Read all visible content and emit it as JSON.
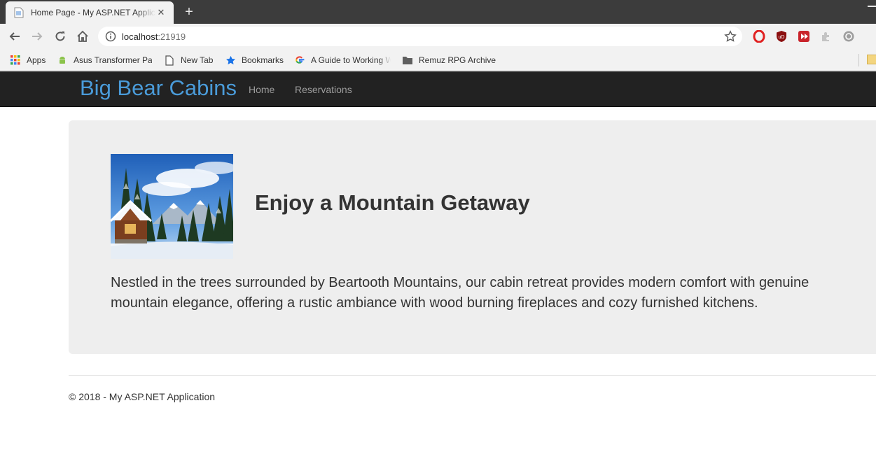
{
  "browser": {
    "tab": {
      "title": "Home Page - My ASP.NET Application",
      "close_glyph": "✕"
    },
    "new_tab_glyph": "+",
    "address": {
      "host": "localhost",
      "port": ":21919"
    },
    "bookmarks": [
      {
        "label": "Apps",
        "icon": "apps-grid-icon"
      },
      {
        "label": "Asus Transformer Pad",
        "icon": "android-icon"
      },
      {
        "label": "New Tab",
        "icon": "page-icon"
      },
      {
        "label": "Bookmarks",
        "icon": "star-icon"
      },
      {
        "label": "A Guide to Working With",
        "icon": "google-icon"
      },
      {
        "label": "Remuz RPG Archive",
        "icon": "folder-icon"
      }
    ],
    "extensions": [
      "opera-icon",
      "ublock-icon",
      "video-speed-icon",
      "puzzle-icon",
      "sync-icon"
    ]
  },
  "site": {
    "brand": "Big Bear Cabins",
    "nav": {
      "home": "Home",
      "reservations": "Reservations"
    },
    "colors": {
      "brand": "#4a9bd9",
      "navbar": "#222222",
      "jumbotron": "#eeeeee"
    }
  },
  "hero": {
    "heading": "Enjoy a Mountain Getaway",
    "text": "Nestled in the trees surrounded by Beartooth Mountains, our cabin retreat provides modern comfort with genuine mountain elegance, offering a rustic ambiance with wood burning fireplaces and cozy furnished kitchens."
  },
  "footer": {
    "text": "© 2018 - My ASP.NET Application"
  }
}
